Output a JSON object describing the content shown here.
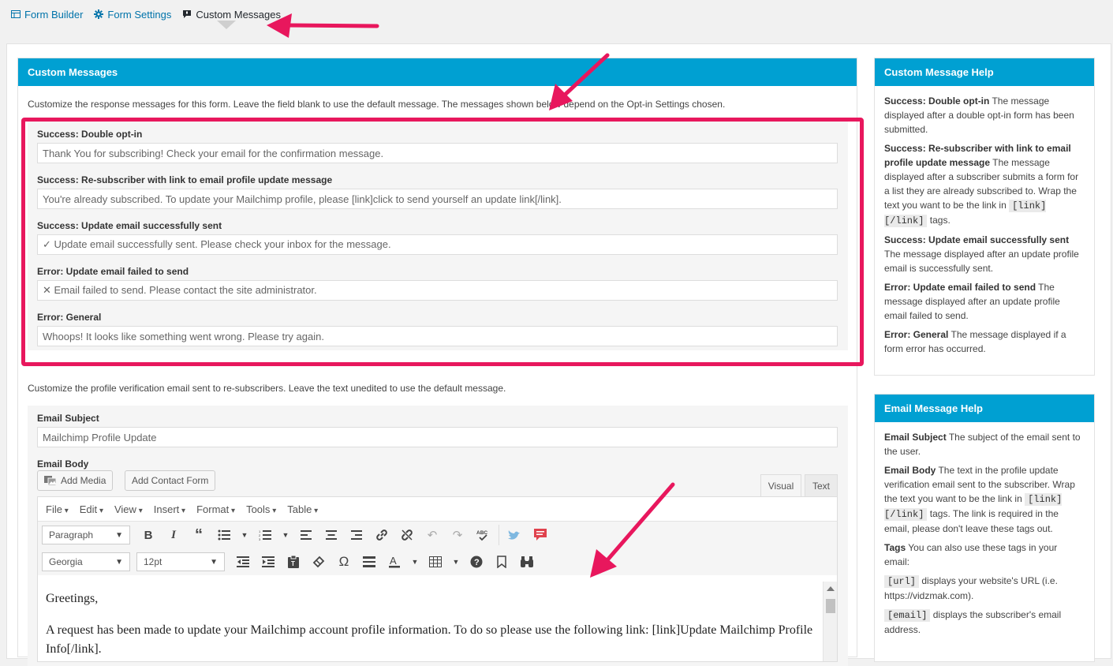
{
  "tabs": [
    {
      "label": "Form Builder",
      "icon": "table-icon"
    },
    {
      "label": "Form Settings",
      "icon": "gear-icon"
    },
    {
      "label": "Custom Messages",
      "icon": "message-icon"
    }
  ],
  "custom_messages": {
    "title": "Custom Messages",
    "description": "Customize the response messages for this form. Leave the field blank to use the default message. The messages shown below depend on the Opt-in Settings chosen.",
    "fields": [
      {
        "label": "Success: Double opt-in",
        "value": "Thank You for subscribing! Check your email for the confirmation message."
      },
      {
        "label": "Success: Re-subscriber with link to email profile update message",
        "value": "You're already subscribed. To update your Mailchimp profile, please [link]click to send yourself an update link[/link]."
      },
      {
        "label": "Success: Update email successfully sent",
        "value": "✓ Update email successfully sent. Please check your inbox for the message."
      },
      {
        "label": "Error: Update email failed to send",
        "value": "✕ Email failed to send. Please contact the site administrator."
      },
      {
        "label": "Error: General",
        "value": "Whoops! It looks like something went wrong. Please try again."
      }
    ]
  },
  "email": {
    "description": "Customize the profile verification email sent to re-subscribers. Leave the text unedited to use the default message.",
    "subject_label": "Email Subject",
    "subject_value": "Mailchimp Profile Update",
    "body_label": "Email Body",
    "add_media": "Add Media",
    "add_contact_form": "Add Contact Form",
    "tab_visual": "Visual",
    "tab_text": "Text",
    "menus": [
      "File",
      "Edit",
      "View",
      "Insert",
      "Format",
      "Tools",
      "Table"
    ],
    "format_select": "Paragraph",
    "font_select": "Georgia",
    "size_select": "12pt",
    "body_p1": "Greetings,",
    "body_p2": "A request has been made to update your Mailchimp account profile information. To do so please use the following link: [link]Update Mailchimp Profile Info[/link]."
  },
  "help": {
    "title": "Custom Message Help",
    "items": [
      {
        "term": "Success: Double opt-in",
        "text": " The message displayed after a double opt-in form has been submitted."
      },
      {
        "term": "Success: Re-subscriber with link to email profile update message",
        "text": " The message displayed after a subscriber submits a form for a list they are already subscribed to. Wrap the text you want to be the link in ",
        "code": "[link][/link]",
        "after": " tags."
      },
      {
        "term": "Success: Update email successfully sent",
        "text": " The message displayed after an update profile email is successfully sent."
      },
      {
        "term": "Error: Update email failed to send",
        "text": " The message displayed after an update profile email failed to send."
      },
      {
        "term": "Error: General",
        "text": " The message displayed if a form error has occurred."
      }
    ]
  },
  "email_help": {
    "title": "Email Message Help",
    "subject_term": "Email Subject",
    "subject_text": " The subject of the email sent to the user.",
    "body_term": "Email Body",
    "body_text": " The text in the profile update verification email sent to the subscriber. Wrap the text you want to be the link in ",
    "body_code": "[link][/link]",
    "body_after": " tags. The link is required in the email, please don't leave these tags out.",
    "tags_term": "Tags",
    "tags_text": " You can also use these tags in your email:",
    "url_code": "[url]",
    "url_text": " displays your website's URL (i.e. https://vidzmak.com).",
    "email_code": "[email]",
    "email_text": " displays the subscriber's email address."
  },
  "colors": {
    "header": "#00a0d2",
    "highlight": "#e8175d",
    "link": "#0073aa"
  }
}
